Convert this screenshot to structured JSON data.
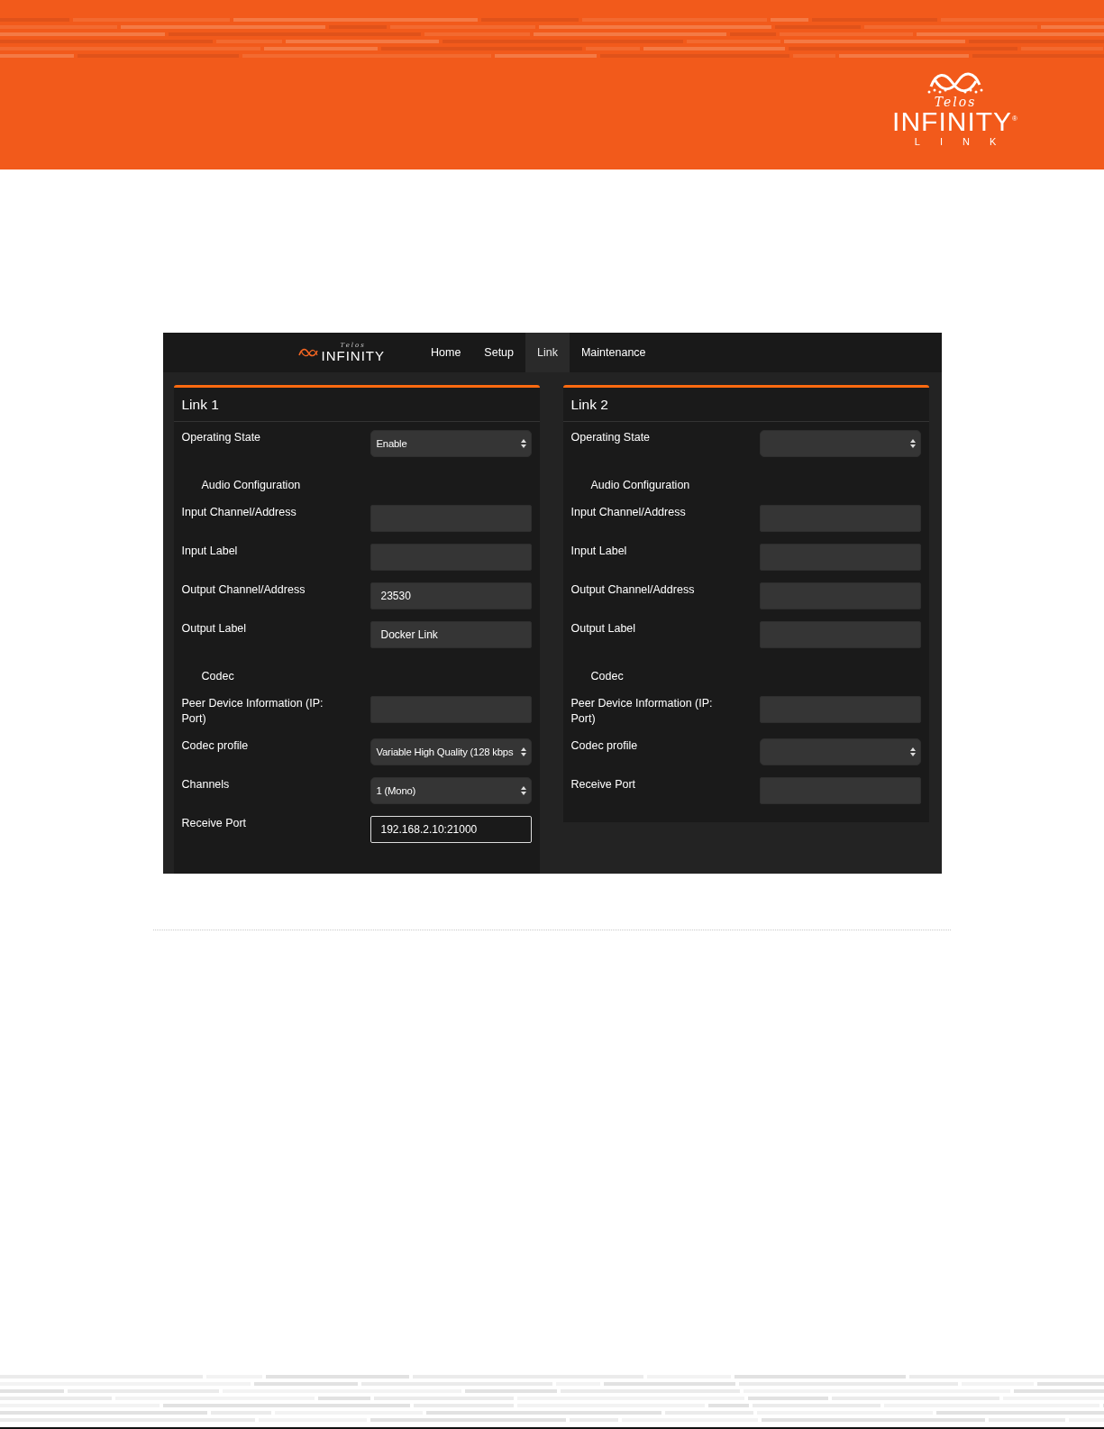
{
  "header": {
    "logo": {
      "brand": "Telos",
      "name": "INFINITY",
      "mark": "®",
      "sub": "LINK"
    }
  },
  "screenshot": {
    "navbar": {
      "logo": {
        "brand": "Telos",
        "name": "INFINITY"
      },
      "items": [
        {
          "label": "Home",
          "selected": false
        },
        {
          "label": "Setup",
          "selected": false
        },
        {
          "label": "Link",
          "selected": true
        },
        {
          "label": "Maintenance",
          "selected": false
        }
      ]
    },
    "panels": [
      {
        "title": "Link 1",
        "rows": [
          {
            "kind": "select",
            "label": "Operating State",
            "value": "Enable"
          },
          {
            "kind": "heading",
            "label": "Audio Configuration"
          },
          {
            "kind": "input",
            "label": "Input Channel/Address",
            "focused": false
          },
          {
            "kind": "input",
            "label": "Input Label",
            "focused": false
          },
          {
            "kind": "input",
            "label": "Output Channel/Address",
            "value": "23530",
            "focused": false
          },
          {
            "kind": "input",
            "label": "Output Label",
            "value": "Docker Link",
            "focused": false
          },
          {
            "kind": "heading",
            "label": "Codec"
          },
          {
            "kind": "input",
            "label": "Peer Device Information (IP: Port)",
            "focused": false
          },
          {
            "kind": "select",
            "label": "Codec profile",
            "value": "Variable High Quality (128 kbps"
          },
          {
            "kind": "select",
            "label": "Channels",
            "value": "1 (Mono)"
          },
          {
            "kind": "input",
            "label": "Receive Port",
            "value": "192.168.2.10:21000",
            "focused": true
          }
        ]
      },
      {
        "title": "Link 2",
        "rows": [
          {
            "kind": "select",
            "label": "Operating State"
          },
          {
            "kind": "heading",
            "label": "Audio Configuration"
          },
          {
            "kind": "input",
            "label": "Input Channel/Address",
            "focused": false
          },
          {
            "kind": "input",
            "label": "Input Label",
            "focused": false
          },
          {
            "kind": "input",
            "label": "Output Channel/Address",
            "focused": false
          },
          {
            "kind": "input",
            "label": "Output Label",
            "focused": false
          },
          {
            "kind": "heading",
            "label": "Codec"
          },
          {
            "kind": "input",
            "label": "Peer Device Information (IP: Port)",
            "focused": false
          },
          {
            "kind": "select",
            "label": "Codec profile"
          },
          {
            "kind": "input",
            "label": "Receive Port",
            "focused": false
          }
        ]
      }
    ]
  }
}
